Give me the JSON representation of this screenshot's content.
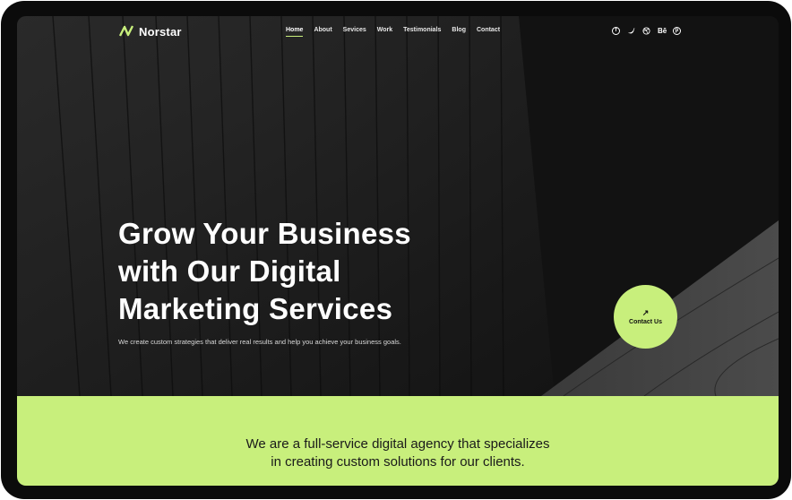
{
  "nav": {
    "logo_text": "Norstar",
    "items": [
      "Home",
      "About",
      "Sevices",
      "Work",
      "Testimonials",
      "Blog",
      "Contact"
    ],
    "active": "Home",
    "social_icons": [
      "facebook-icon",
      "twitter-icon",
      "dribbble-icon",
      "behance-icon",
      "pinterest-icon"
    ],
    "behance_text": "Bē"
  },
  "hero": {
    "headline_lines": [
      "Grow Your Business",
      "with Our Digital",
      "Marketing Services"
    ],
    "subtext": "We create custom strategies that deliver real results and help you achieve your business goals.",
    "cta_label": "Contact Us",
    "cta_arrow": "↗"
  },
  "band": {
    "lines": [
      "We are a full-service digital agency that specializes",
      "in creating custom solutions for our clients."
    ]
  },
  "colors": {
    "accent": "#c8ef7c",
    "dark": "#151515",
    "device_frame": "#0b0b0b"
  }
}
